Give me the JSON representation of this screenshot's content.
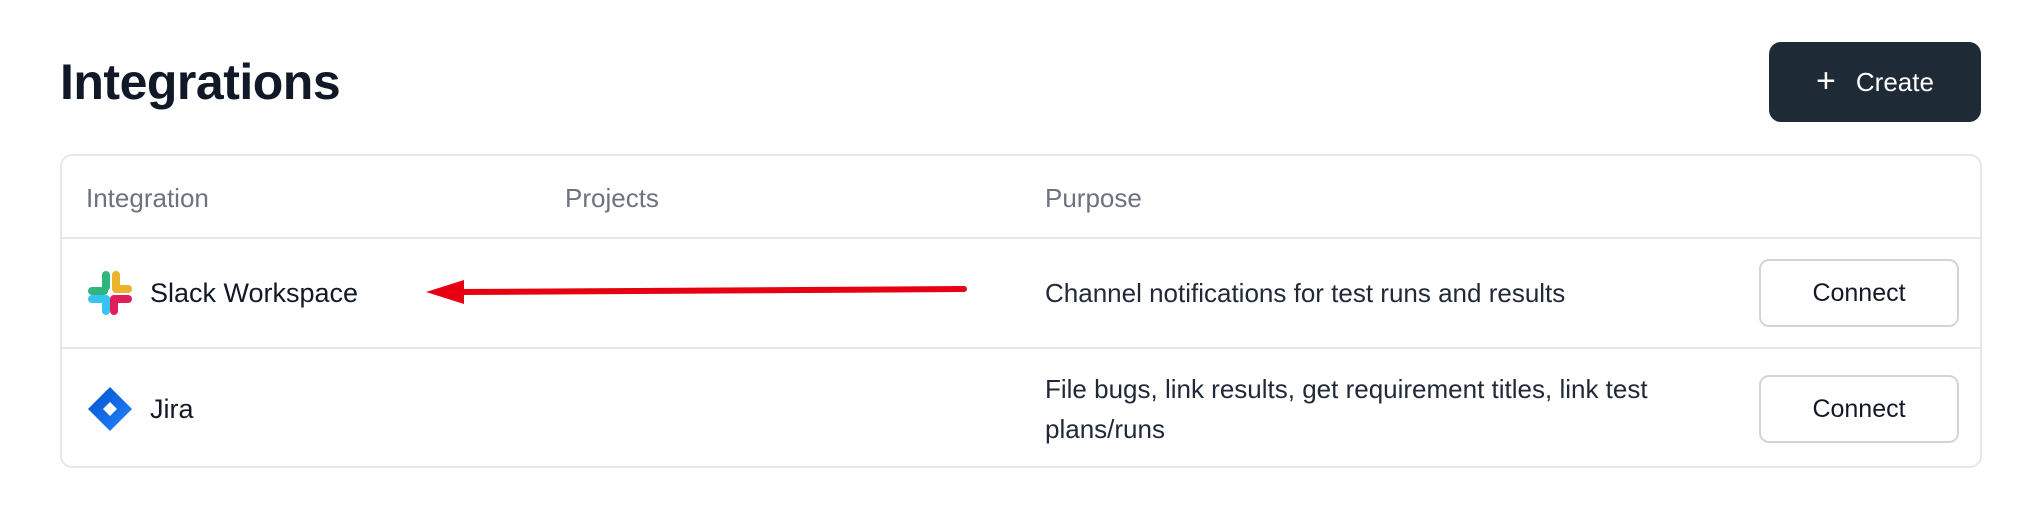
{
  "page": {
    "title": "Integrations"
  },
  "toolbar": {
    "create_label": "Create",
    "create_icon": "plus-icon"
  },
  "table": {
    "columns": [
      "Integration",
      "Projects",
      "Purpose"
    ],
    "rows": [
      {
        "name": "Slack Workspace",
        "icon": "slack-icon",
        "projects": "",
        "purpose": "Channel notifications for test runs and results",
        "action": "Connect"
      },
      {
        "name": "Jira",
        "icon": "jira-icon",
        "projects": "",
        "purpose": "File bugs, link results, get requirement titles, link test plans/runs",
        "action": "Connect"
      }
    ]
  },
  "colors": {
    "primary_button": "#1f2a37",
    "annotation_arrow": "#e60012",
    "jira_blue": "#2684ff"
  }
}
